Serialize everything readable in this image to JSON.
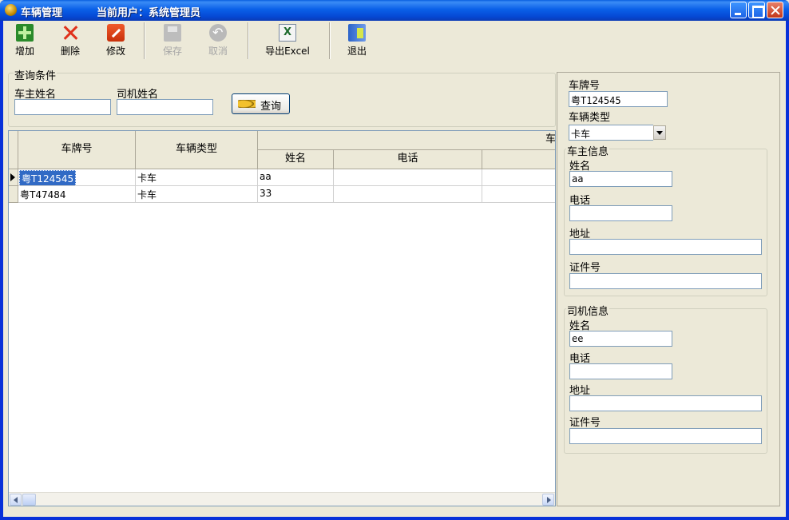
{
  "window": {
    "title": "车辆管理",
    "current_user": "当前用户：系统管理员"
  },
  "toolbar": {
    "add_label": "增加",
    "delete_label": "删除",
    "edit_label": "修改",
    "save_label": "保存",
    "cancel_label": "取消",
    "export_label": "导出Excel",
    "exit_label": "退出"
  },
  "query": {
    "title": "查询条件",
    "owner_name_label": "车主姓名",
    "owner_name_value": "",
    "driver_name_label": "司机姓名",
    "driver_name_value": "",
    "search_button": "查询"
  },
  "grid": {
    "headers": {
      "plate": "车牌号",
      "vehicle_type": "车辆类型",
      "owner_group": "车",
      "owner_name": "姓名",
      "owner_phone": "电话"
    },
    "rows": [
      {
        "plate": "粤T124545",
        "vehicle_type": "卡车",
        "owner_name": "aa",
        "owner_phone": ""
      },
      {
        "plate": "粤T47484",
        "vehicle_type": "卡车",
        "owner_name": "33",
        "owner_phone": ""
      }
    ]
  },
  "detail": {
    "plate_label": "车牌号",
    "plate_value": "粤T124545",
    "type_label": "车辆类型",
    "type_value": "卡车",
    "owner": {
      "title": "车主信息",
      "name_label": "姓名",
      "name_value": "aa",
      "phone_label": "电话",
      "phone_value": "",
      "address_label": "地址",
      "address_value": "",
      "id_label": "证件号",
      "id_value": ""
    },
    "driver": {
      "title": "司机信息",
      "name_label": "姓名",
      "name_value": "ee",
      "phone_label": "电话",
      "phone_value": "",
      "address_label": "地址",
      "address_value": "",
      "id_label": "证件号",
      "id_value": ""
    }
  },
  "colors": {
    "titlebar": "#0A60E8",
    "window_bg": "#ECE9D8",
    "selection": "#316AC5"
  }
}
